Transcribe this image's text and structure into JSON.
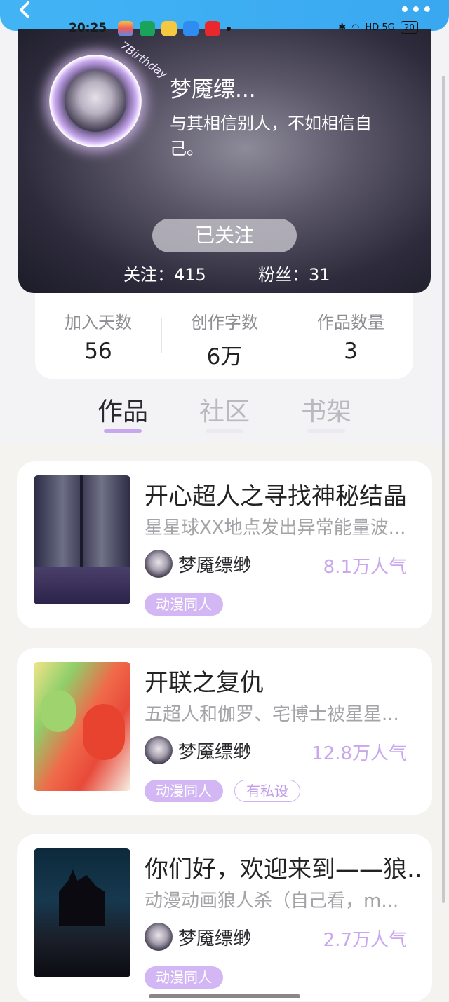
{
  "status_bar": {
    "time": "20:25",
    "right": "HD 5G",
    "battery": "20"
  },
  "header": {
    "more_label": "•••"
  },
  "profile": {
    "name": "梦魇缥...",
    "bio": "与其相信别人，不如相信自己。",
    "avatar_badge": "7Birthday",
    "follow_button": "已关注",
    "following": "关注：415",
    "fans": "粉丝：31"
  },
  "summary": [
    {
      "label": "加入天数",
      "value": "56"
    },
    {
      "label": "创作字数",
      "value": "6万"
    },
    {
      "label": "作品数量",
      "value": "3"
    }
  ],
  "tabs": [
    "作品",
    "社区",
    "书架"
  ],
  "books": [
    {
      "title": "开心超人之寻找神秘结晶",
      "desc": "星星球XX地点发出异常能量波...",
      "author": "梦魇缥缈",
      "popularity": "8.1万人气",
      "tags": [
        "动漫同人"
      ]
    },
    {
      "title": "开联之复仇",
      "desc": "五超人和伽罗、宅博士被星星...",
      "author": "梦魇缥缈",
      "popularity": "12.8万人气",
      "tags": [
        "动漫同人"
      ],
      "outline_tag": "有私设"
    },
    {
      "title": "你们好，欢迎来到——狼...",
      "desc": "动漫动画狼人杀（自己看，m...",
      "author": "梦魇缥缈",
      "popularity": "2.7万人气",
      "tags": [
        "动漫同人"
      ]
    }
  ],
  "colors": {
    "accent": "#c9a7ee",
    "topbar": "#42b4f5"
  }
}
